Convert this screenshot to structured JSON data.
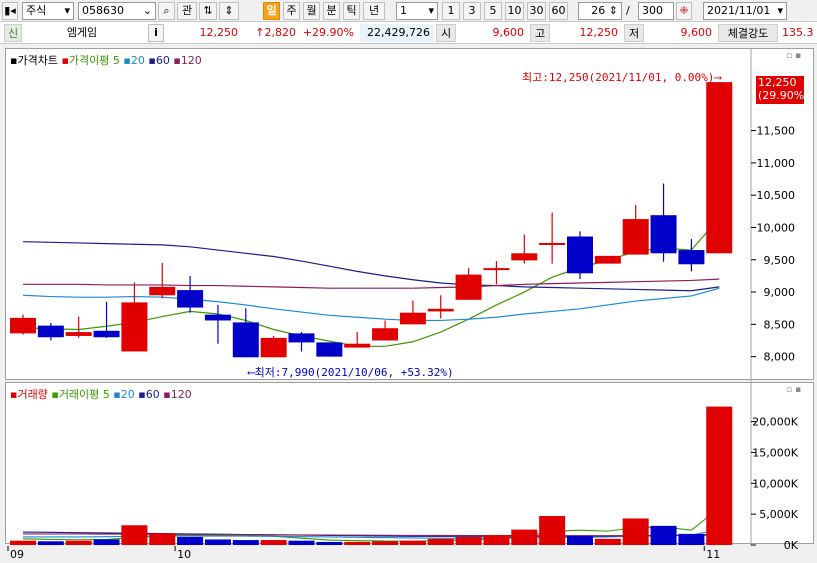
{
  "toolbar": {
    "market": "주식",
    "code": "058630",
    "search_btn": "관",
    "periods": [
      "일",
      "주",
      "월",
      "분",
      "틱",
      "년"
    ],
    "active_period": "일",
    "interval": "1",
    "nums": [
      "1",
      "3",
      "5",
      "10",
      "30",
      "60"
    ],
    "count": "26",
    "total": "300",
    "total_sep": "/",
    "date": "2021/11/01"
  },
  "infobar": {
    "tag": "신",
    "name": "엠게임",
    "info_btn": "i",
    "price": "12,250",
    "change": "↑2,820",
    "pct": "+29.90%",
    "volume": "22,429,726",
    "open_label": "시",
    "open": "9,600",
    "high_label": "고",
    "high": "12,250",
    "low_label": "저",
    "low": "9,600",
    "strength_label": "체결강도",
    "strength": "135.3"
  },
  "colors": {
    "up": "#e00000",
    "down": "#0000c8",
    "ma5": "#3a9a00",
    "ma20": "#1e88d8",
    "ma60": "#1c1c8c",
    "ma120": "#8c1c5c"
  },
  "price_panel": {
    "legend": {
      "title": "가격차트",
      "ma_label": "가격이평",
      "p5": "5",
      "p20": "20",
      "p60": "60",
      "p120": "120"
    },
    "high_note": "최고:12,250(2021/11/01, 0.00%)⟶",
    "low_note": "⟵최저:7,990(2021/10/06, +53.32%)",
    "last_price": "12,250",
    "last_pct": "(29.90%)"
  },
  "volume_panel": {
    "legend": {
      "title": "거래량",
      "ma_label": "거래이평",
      "p5": "5",
      "p20": "20",
      "p60": "60",
      "p120": "120"
    }
  },
  "chart_data": {
    "type": "candlestick",
    "price_ylim": [
      7700,
      12500
    ],
    "price_ticks": [
      8000,
      8500,
      9000,
      9500,
      10000,
      10500,
      11000,
      11500
    ],
    "price_tick_labels": [
      "8,000",
      "8,500",
      "9,000",
      "9,500",
      "10,000",
      "10,500",
      "11,000",
      "11,500"
    ],
    "volume_ylim": [
      0,
      23500
    ],
    "volume_ticks": [
      0,
      5000,
      10000,
      15000,
      20000
    ],
    "volume_tick_labels": [
      "0K",
      "5,000K",
      "10,000K",
      "15,000K",
      "20,000K"
    ],
    "x_labels": [
      {
        "i": 0,
        "label": "09"
      },
      {
        "i": 6,
        "label": "10"
      },
      {
        "i": 25,
        "label": "11"
      }
    ],
    "candles": [
      {
        "o": 8360,
        "h": 8650,
        "c": 8600,
        "l": 8340
      },
      {
        "o": 8480,
        "h": 8520,
        "c": 8300,
        "l": 8250
      },
      {
        "o": 8320,
        "h": 8620,
        "c": 8380,
        "l": 8290
      },
      {
        "o": 8400,
        "h": 8850,
        "c": 8300,
        "l": 8290
      },
      {
        "o": 8080,
        "h": 9150,
        "c": 8840,
        "l": 8080
      },
      {
        "o": 8950,
        "h": 9450,
        "c": 9080,
        "l": 8900
      },
      {
        "o": 9030,
        "h": 9250,
        "c": 8760,
        "l": 8680
      },
      {
        "o": 8650,
        "h": 8800,
        "c": 8560,
        "l": 8200
      },
      {
        "o": 8530,
        "h": 8750,
        "c": 7990,
        "l": 7990
      },
      {
        "o": 7990,
        "h": 8320,
        "c": 8290,
        "l": 7990
      },
      {
        "o": 8360,
        "h": 8380,
        "c": 8220,
        "l": 8080
      },
      {
        "o": 8220,
        "h": 8220,
        "c": 8000,
        "l": 8000
      },
      {
        "o": 8140,
        "h": 8380,
        "c": 8200,
        "l": 8140
      },
      {
        "o": 8250,
        "h": 8560,
        "c": 8440,
        "l": 8250
      },
      {
        "o": 8500,
        "h": 8870,
        "c": 8680,
        "l": 8500
      },
      {
        "o": 8700,
        "h": 8950,
        "c": 8740,
        "l": 8590
      },
      {
        "o": 8880,
        "h": 9370,
        "c": 9270,
        "l": 8880
      },
      {
        "o": 9360,
        "h": 9480,
        "c": 9370,
        "l": 9120
      },
      {
        "o": 9490,
        "h": 9890,
        "c": 9600,
        "l": 9440
      },
      {
        "o": 9760,
        "h": 10230,
        "c": 9760,
        "l": 9440
      },
      {
        "o": 9860,
        "h": 9940,
        "c": 9290,
        "l": 9200
      },
      {
        "o": 9440,
        "h": 9510,
        "c": 9560,
        "l": 9440
      },
      {
        "o": 9580,
        "h": 10350,
        "c": 10130,
        "l": 9580
      },
      {
        "o": 10190,
        "h": 10680,
        "c": 9600,
        "l": 9470
      },
      {
        "o": 9650,
        "h": 9820,
        "c": 9430,
        "l": 9320
      },
      {
        "o": 9600,
        "h": 12250,
        "c": 12250,
        "l": 9600
      }
    ],
    "ma_series": [
      {
        "name": "5",
        "values": [
          8450,
          8430,
          8420,
          8470,
          8530,
          8620,
          8700,
          8660,
          8560,
          8420,
          8320,
          8240,
          8160,
          8160,
          8230,
          8380,
          8580,
          8800,
          9000,
          9230,
          9380,
          9490,
          9630,
          9680,
          9650,
          10150
        ]
      },
      {
        "name": "20",
        "values": [
          8950,
          8930,
          8920,
          8920,
          8930,
          8920,
          8890,
          8850,
          8800,
          8740,
          8690,
          8640,
          8610,
          8580,
          8560,
          8560,
          8580,
          8610,
          8660,
          8700,
          8740,
          8800,
          8860,
          8900,
          8940,
          9060
        ]
      },
      {
        "name": "60",
        "values": [
          9780,
          9770,
          9760,
          9750,
          9740,
          9730,
          9700,
          9650,
          9600,
          9550,
          9480,
          9400,
          9320,
          9250,
          9190,
          9140,
          9110,
          9100,
          9080,
          9070,
          9060,
          9050,
          9040,
          9030,
          9020,
          9080
        ]
      },
      {
        "name": "120",
        "values": [
          9120,
          9120,
          9120,
          9110,
          9110,
          9110,
          9100,
          9100,
          9090,
          9080,
          9070,
          9060,
          9060,
          9060,
          9060,
          9070,
          9080,
          9100,
          9120,
          9130,
          9140,
          9150,
          9160,
          9170,
          9180,
          9200
        ]
      }
    ],
    "volume": [
      700,
      600,
      700,
      900,
      3200,
      1900,
      1300,
      900,
      800,
      800,
      700,
      500,
      500,
      600,
      700,
      1000,
      1300,
      1600,
      2500,
      4700,
      1500,
      1000,
      4300,
      3100,
      1800,
      22430
    ],
    "volume_ma": [
      {
        "name": "5",
        "values": [
          1000,
          900,
          850,
          900,
          1200,
          1500,
          1600,
          1650,
          1600,
          1400,
          1100,
          800,
          700,
          650,
          600,
          700,
          850,
          1050,
          1400,
          2200,
          2400,
          2250,
          2800,
          2900,
          2400,
          6000
        ]
      },
      {
        "name": "20",
        "values": [
          1300,
          1300,
          1300,
          1350,
          1400,
          1450,
          1450,
          1450,
          1450,
          1400,
          1350,
          1300,
          1250,
          1200,
          1150,
          1100,
          1100,
          1100,
          1100,
          1200,
          1250,
          1300,
          1450,
          1550,
          1600,
          2500
        ]
      },
      {
        "name": "60",
        "values": [
          2100,
          2050,
          2000,
          1950,
          1900,
          1850,
          1800,
          1750,
          1700,
          1650,
          1600,
          1550,
          1500,
          1450,
          1400,
          1400,
          1400,
          1400,
          1400,
          1400,
          1450,
          1450,
          1500,
          1550,
          1550,
          1800
        ]
      },
      {
        "name": "120",
        "values": [
          1800,
          1800,
          1800,
          1780,
          1760,
          1740,
          1720,
          1700,
          1680,
          1660,
          1640,
          1620,
          1600,
          1580,
          1560,
          1550,
          1540,
          1530,
          1520,
          1520,
          1520,
          1520,
          1530,
          1540,
          1540,
          1600
        ]
      }
    ]
  }
}
